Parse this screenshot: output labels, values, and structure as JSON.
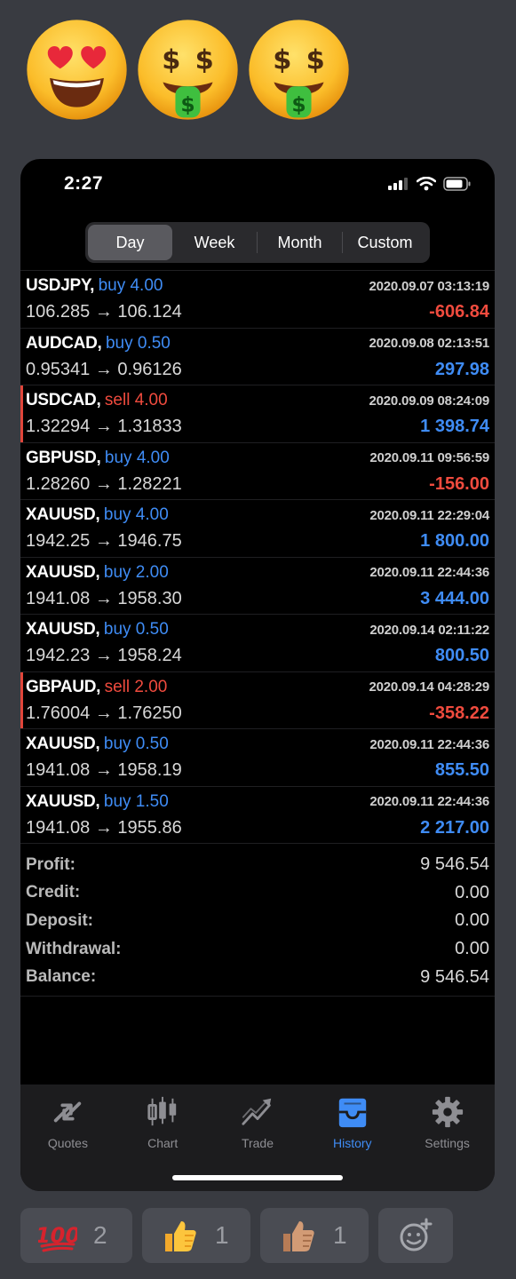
{
  "header_emojis": [
    "heart-eyes-emoji",
    "money-mouth-emoji",
    "money-mouth-emoji"
  ],
  "status_bar": {
    "time": "2:27"
  },
  "period_tabs": [
    {
      "label": "Day",
      "active": true
    },
    {
      "label": "Week",
      "active": false
    },
    {
      "label": "Month",
      "active": false
    },
    {
      "label": "Custom",
      "active": false
    }
  ],
  "trades": [
    {
      "symbol": "USDJPY,",
      "side": "buy",
      "side_label": "buy 4.00",
      "date": "2020.09.07 03:13:19",
      "prices": "106.285 → 106.124",
      "profit": "-606.84",
      "positive": false
    },
    {
      "symbol": "AUDCAD,",
      "side": "buy",
      "side_label": "buy 0.50",
      "date": "2020.09.08 02:13:51",
      "prices": "0.95341 → 0.96126",
      "profit": "297.98",
      "positive": true
    },
    {
      "symbol": "USDCAD,",
      "side": "sell",
      "side_label": "sell 4.00",
      "date": "2020.09.09 08:24:09",
      "prices": "1.32294 → 1.31833",
      "profit": "1 398.74",
      "positive": true
    },
    {
      "symbol": "GBPUSD,",
      "side": "buy",
      "side_label": "buy 4.00",
      "date": "2020.09.11 09:56:59",
      "prices": "1.28260 → 1.28221",
      "profit": "-156.00",
      "positive": false
    },
    {
      "symbol": "XAUUSD,",
      "side": "buy",
      "side_label": "buy 4.00",
      "date": "2020.09.11 22:29:04",
      "prices": "1942.25 → 1946.75",
      "profit": "1 800.00",
      "positive": true
    },
    {
      "symbol": "XAUUSD,",
      "side": "buy",
      "side_label": "buy 2.00",
      "date": "2020.09.11 22:44:36",
      "prices": "1941.08 → 1958.30",
      "profit": "3 444.00",
      "positive": true
    },
    {
      "symbol": "XAUUSD,",
      "side": "buy",
      "side_label": "buy 0.50",
      "date": "2020.09.14 02:11:22",
      "prices": "1942.23 → 1958.24",
      "profit": "800.50",
      "positive": true
    },
    {
      "symbol": "GBPAUD,",
      "side": "sell",
      "side_label": "sell 2.00",
      "date": "2020.09.14 04:28:29",
      "prices": "1.76004 → 1.76250",
      "profit": "-358.22",
      "positive": false
    },
    {
      "symbol": "XAUUSD,",
      "side": "buy",
      "side_label": "buy 0.50",
      "date": "2020.09.11 22:44:36",
      "prices": "1941.08 → 1958.19",
      "profit": "855.50",
      "positive": true
    },
    {
      "symbol": "XAUUSD,",
      "side": "buy",
      "side_label": "buy 1.50",
      "date": "2020.09.11 22:44:36",
      "prices": "1941.08 → 1955.86",
      "profit": "2 217.00",
      "positive": true
    }
  ],
  "summary": [
    {
      "label": "Profit:",
      "value": "9 546.54"
    },
    {
      "label": "Credit:",
      "value": "0.00"
    },
    {
      "label": "Deposit:",
      "value": "0.00"
    },
    {
      "label": "Withdrawal:",
      "value": "0.00"
    },
    {
      "label": "Balance:",
      "value": "9 546.54"
    }
  ],
  "tabbar": [
    {
      "label": "Quotes",
      "icon": "quotes-icon",
      "active": false
    },
    {
      "label": "Chart",
      "icon": "candlestick-chart-icon",
      "active": false
    },
    {
      "label": "Trade",
      "icon": "trade-trend-icon",
      "active": false
    },
    {
      "label": "History",
      "icon": "history-tray-icon",
      "active": true
    },
    {
      "label": "Settings",
      "icon": "gear-icon",
      "active": false
    }
  ],
  "reactions": [
    {
      "emoji": "hundred-points-emoji",
      "count": "2"
    },
    {
      "emoji": "thumbs-up-emoji",
      "count": "1"
    },
    {
      "emoji": "thumbs-up-medium-skin-emoji",
      "count": "1"
    }
  ],
  "colors": {
    "buy": "#3f8cf5",
    "sell": "#f04b3e",
    "accent": "#3f8cf5",
    "background": "#393b41"
  }
}
